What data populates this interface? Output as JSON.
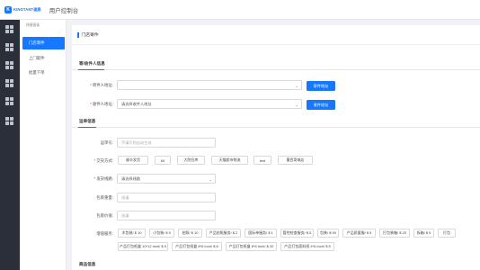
{
  "brand": {
    "logo_text": "KINGTANT速鼎",
    "console_title": "用户控制台"
  },
  "submenu": {
    "title": "快捷面板",
    "items": [
      {
        "label": "门店寄件",
        "active": true
      },
      {
        "label": "上门取件",
        "active": false
      },
      {
        "label": "批量下单",
        "active": false
      }
    ]
  },
  "page": {
    "title": "门店寄件"
  },
  "sender_section": {
    "tab": "寄/收件人信息",
    "sender": {
      "label": "寄件人地址:",
      "value": "",
      "button": "寄件地址"
    },
    "receiver": {
      "label": "收件人地址:",
      "value": "请选择收件人地址",
      "button": "收件地址"
    }
  },
  "order_section": {
    "tab": "运单信息",
    "waybill": {
      "label": "运单号:",
      "placeholder": "不填写则自动生成"
    },
    "handover": {
      "label": "交货方式:",
      "options": [
        "顺丰发货",
        "60",
        "大院仓库",
        "天猫超市物流",
        "test",
        "墨西哥城店"
      ]
    },
    "route": {
      "label": "发货线路:",
      "value": "请选择线路"
    },
    "weight": {
      "label": "包裹重量:",
      "placeholder": "选填"
    },
    "value": {
      "label": "包裹价值:",
      "placeholder": "选填"
    },
    "services": {
      "label": "增值服务:",
      "row1": [
        "木包装/ $ 10",
        "小包装/ $ 5",
        "拍照/ $ 10",
        "产品拍照服务/ $ 2",
        "国际单服务/ $ 1",
        "管控检查服务/ $ 5",
        "包装/ $ 50",
        "产品质量服/ $ 5",
        "打包装箱/ $ 20",
        "拆箱/ $ 5",
        "打包"
      ],
      "row2": [
        "产品打包纸盒 10*12 Inch/ $ 9",
        "产品打包纸盒 8*6 Inch/ $ 8",
        "产品打包纸盒 6*6 Inch/ $ 20",
        "产品打包面料纸 4*6 Inch/ $ 5"
      ]
    }
  },
  "goods_section": {
    "tab": "商品信息"
  }
}
